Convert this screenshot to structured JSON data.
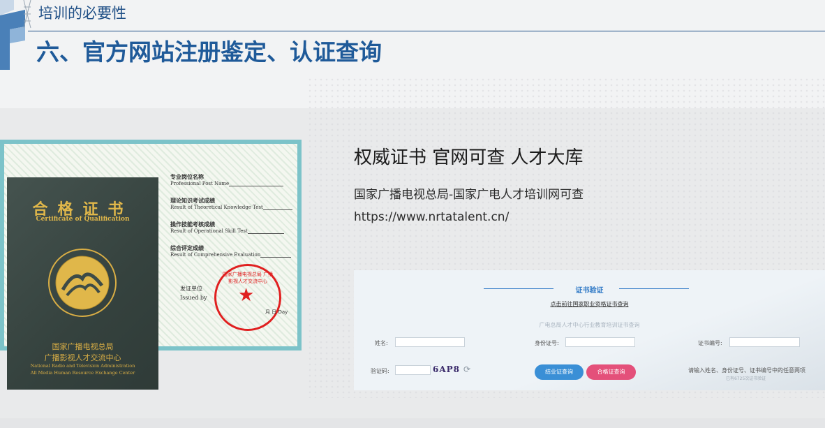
{
  "header": {
    "subtitle": "培训的必要性",
    "title": "六、官方网站注册鉴定、认证查询"
  },
  "certificate": {
    "cover_title": "合格证书",
    "cover_subtitle": "Certificate of Qualification",
    "cover_org_line1": "国家广播电视总局",
    "cover_org_line2": "广播影视人才交流中心",
    "cover_org_en_line1": "National Radio and Television Administration",
    "cover_org_en_line2": "All Media Human Resource Exchange Center",
    "fields": [
      {
        "cn": "专业岗位名称",
        "en": "Professional Post Name"
      },
      {
        "cn": "理论知识考试成绩",
        "en": "Result of Theoretical Knowledge Test"
      },
      {
        "cn": "操作技能考核成绩",
        "en": "Result of Operational Skill Test"
      },
      {
        "cn": "综合评定成绩",
        "en": "Result of Comprehensive Evaluation"
      }
    ],
    "issuer_cn": "发证单位",
    "issuer_en": "Issued by",
    "seal_text": "国家广播电视总局 广播影视人才交流中心",
    "date_text": "月 日 Day"
  },
  "info": {
    "slogan": "权威证书  官网可查  人才大库",
    "description": "国家广播电视总局-国家广电人才培训网可查",
    "url": "https://www.nrtatalent.cn/"
  },
  "verify_form": {
    "heading": "证书验证",
    "link": "点击前往国家职业资格证书查询",
    "note": "广电总局人才中心行业教育培训证书查询",
    "name_label": "姓名:",
    "id_label": "身份证号:",
    "cert_no_label": "证书编号:",
    "captcha_label": "验证码:",
    "captcha_value": "6AP8",
    "btn_completion": "结业证查询",
    "btn_qualification": "合格证查询",
    "hint": "请输入姓名、身份证号、证书编号中的任意两项",
    "count": "已有6725次证书验证",
    "colors": {
      "primary": "#2f79c6",
      "completion_btn": "#3a8fd6",
      "qualification_btn": "#e4507a"
    }
  },
  "colors": {
    "title_blue": "#1f5a99",
    "cover_green": "#3d4b47",
    "gold": "#e0b74a",
    "seal_red": "#e02020"
  }
}
